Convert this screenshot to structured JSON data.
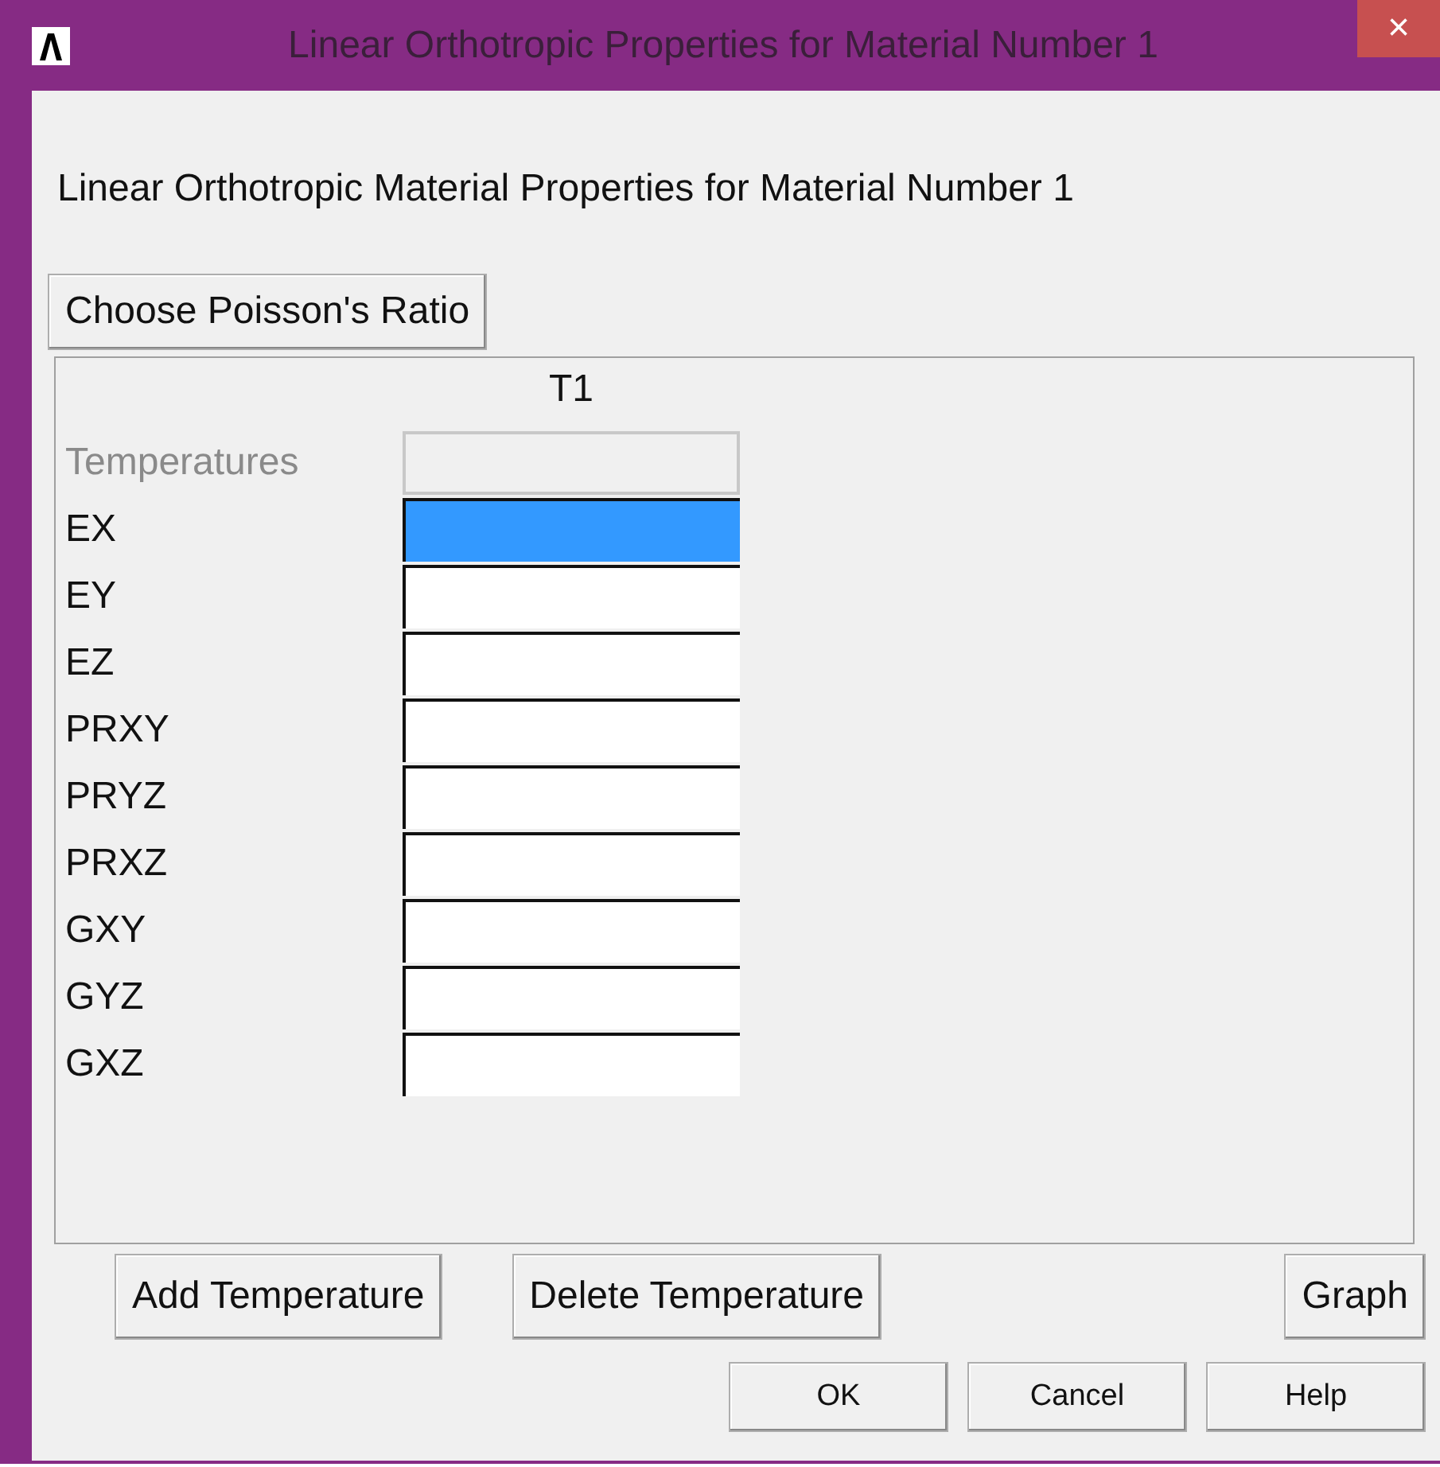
{
  "window": {
    "title": "Linear Orthotropic Properties for Material Number 1",
    "close": "×"
  },
  "heading": "Linear Orthotropic Material Properties for Material Number 1",
  "choose_button": "Choose Poisson's Ratio",
  "table": {
    "columns": [
      "T1"
    ],
    "rows": [
      {
        "label": "Temperatures",
        "disabled": true,
        "selected": false
      },
      {
        "label": "EX",
        "disabled": false,
        "selected": true
      },
      {
        "label": "EY",
        "disabled": false,
        "selected": false
      },
      {
        "label": "EZ",
        "disabled": false,
        "selected": false
      },
      {
        "label": "PRXY",
        "disabled": false,
        "selected": false
      },
      {
        "label": "PRYZ",
        "disabled": false,
        "selected": false
      },
      {
        "label": "PRXZ",
        "disabled": false,
        "selected": false
      },
      {
        "label": "GXY",
        "disabled": false,
        "selected": false
      },
      {
        "label": "GYZ",
        "disabled": false,
        "selected": false
      },
      {
        "label": "GXZ",
        "disabled": false,
        "selected": false
      }
    ]
  },
  "table_buttons": [
    "Add Temperature",
    "Delete Temperature",
    "Graph"
  ],
  "dialog_buttons": [
    "OK",
    "Cancel",
    "Help"
  ]
}
